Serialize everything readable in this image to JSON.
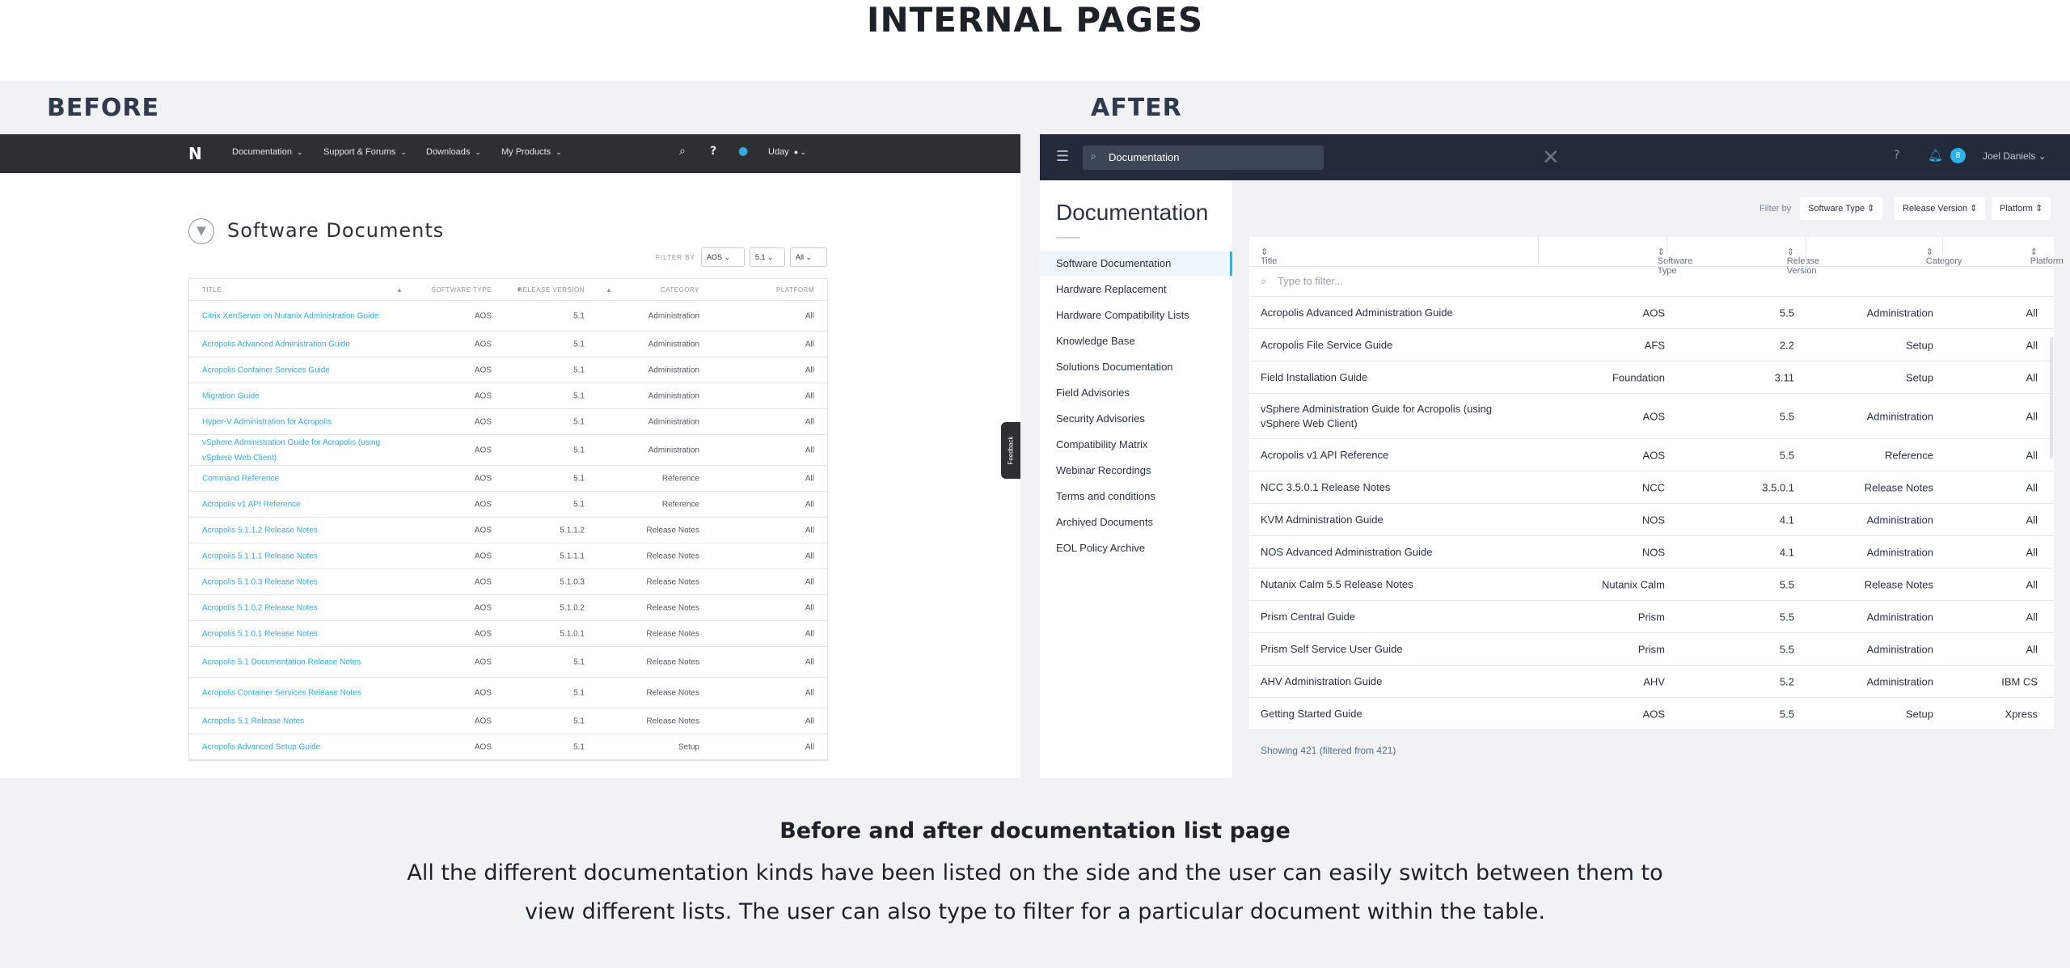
{
  "page": {
    "title": "INTERNAL PAGES",
    "before_label": "BEFORE",
    "after_label": "AFTER"
  },
  "before": {
    "nav": {
      "logo": "N",
      "items": [
        "Documentation",
        "Support & Forums",
        "Downloads",
        "My Products"
      ],
      "user": "Uday"
    },
    "heading": "Software Documents",
    "filter_by": "FILTER BY",
    "selects": [
      "AOS",
      "5.1",
      "All"
    ],
    "columns": [
      "TITLE",
      "SOFTWARE TYPE",
      "RELEASE VERSION",
      "CATEGORY",
      "PLATFORM"
    ],
    "rows": [
      [
        "Citrix XenServer on Nutanix Administration Guide",
        "AOS",
        "5.1",
        "Administration",
        "All"
      ],
      [
        "Acropolis Advanced Administration Guide",
        "AOS",
        "5.1",
        "Administration",
        "All"
      ],
      [
        "Acropolis Container Services Guide",
        "AOS",
        "5.1",
        "Administration",
        "All"
      ],
      [
        "Migration Guide",
        "AOS",
        "5.1",
        "Administration",
        "All"
      ],
      [
        "Hyper-V Administration for Acropolis",
        "AOS",
        "5.1",
        "Administration",
        "All"
      ],
      [
        "vSphere Administration Guide for Acropolis (using vSphere Web Client)",
        "AOS",
        "5.1",
        "Administration",
        "All"
      ],
      [
        "Command Reference",
        "AOS",
        "5.1",
        "Reference",
        "All"
      ],
      [
        "Acropolis v1 API Reference",
        "AOS",
        "5.1",
        "Reference",
        "All"
      ],
      [
        "Acropolis 5.1.1.2 Release Notes",
        "AOS",
        "5.1.1.2",
        "Release Notes",
        "All"
      ],
      [
        "Acropolis 5.1.1.1 Release Notes",
        "AOS",
        "5.1.1.1",
        "Release Notes",
        "All"
      ],
      [
        "Acropolis 5.1.0.3 Release Notes",
        "AOS",
        "5.1.0.3",
        "Release Notes",
        "All"
      ],
      [
        "Acropolis 5.1.0.2 Release Notes",
        "AOS",
        "5.1.0.2",
        "Release Notes",
        "All"
      ],
      [
        "Acropolis 5.1.0.1 Release Notes",
        "AOS",
        "5.1.0.1",
        "Release Notes",
        "All"
      ],
      [
        "Acropolis 5.1 Documentation Release Notes",
        "AOS",
        "5.1",
        "Release Notes",
        "All"
      ],
      [
        "Acropolis Container Services Release Notes",
        "AOS",
        "5.1",
        "Release Notes",
        "All"
      ],
      [
        "Acropolis 5.1 Release Notes",
        "AOS",
        "5.1",
        "Release Notes",
        "All"
      ],
      [
        "Acropolis Advanced Setup Guide",
        "AOS",
        "5.1",
        "Setup",
        "All"
      ]
    ],
    "feedback": "Feedback"
  },
  "after": {
    "nav": {
      "search_value": "Documentation",
      "badge": "8",
      "user": "Joel Daniels"
    },
    "sidebar": {
      "title": "Documentation",
      "items": [
        "Software Documentation",
        "Hardware Replacement",
        "Hardware Compatibility Lists",
        "Knowledge Base",
        "Solutions Documentation",
        "Field Advisories",
        "Security Advisories",
        "Compatibility Matrix",
        "Webinar Recordings",
        "Terms and conditions",
        "Archived Documents",
        "EOL Policy Archive"
      ]
    },
    "filter_by": "Filter by",
    "filters": [
      "Software Type",
      "Release Version",
      "Platform"
    ],
    "columns": [
      "Title",
      "Software Type",
      "Release Version",
      "Category",
      "Platform"
    ],
    "filter_placeholder": "Type to filter...",
    "rows": [
      [
        "Acropolis Advanced Administration Guide",
        "AOS",
        "5.5",
        "Administration",
        "All"
      ],
      [
        "Acropolis File Service Guide",
        "AFS",
        "2.2",
        "Setup",
        "All"
      ],
      [
        "Field Installation Guide",
        "Foundation",
        "3.11",
        "Setup",
        "All"
      ],
      [
        "vSphere Administration Guide for Acropolis (using vSphere Web Client)",
        "AOS",
        "5.5",
        "Administration",
        "All"
      ],
      [
        "Acropolis v1 API Reference",
        "AOS",
        "5.5",
        "Reference",
        "All"
      ],
      [
        "NCC 3.5.0.1 Release Notes",
        "NCC",
        "3.5.0.1",
        "Release Notes",
        "All"
      ],
      [
        "KVM Administration Guide",
        "NOS",
        "4.1",
        "Administration",
        "All"
      ],
      [
        "NOS Advanced Administration Guide",
        "NOS",
        "4.1",
        "Administration",
        "All"
      ],
      [
        "Nutanix Calm 5.5 Release Notes",
        "Nutanix Calm",
        "5.5",
        "Release Notes",
        "All"
      ],
      [
        "Prism Central Guide",
        "Prism",
        "5.5",
        "Administration",
        "All"
      ],
      [
        "Prism Self Service User Guide",
        "Prism",
        "5.5",
        "Administration",
        "All"
      ],
      [
        "AHV Administration Guide",
        "AHV",
        "5.2",
        "Administration",
        "IBM CS"
      ],
      [
        "Getting Started Guide",
        "AOS",
        "5.5",
        "Setup",
        "Xpress"
      ]
    ],
    "showing": "Showing 421 (filtered from 421)"
  },
  "caption": {
    "title": "Before and after documentation list page",
    "body": "All the different documentation kinds have been listed on the side and the user can easily switch between them to view different lists. The user can also type to filter for a particular document within the table."
  },
  "colors": {
    "before_link": "#30aee4",
    "after_nav": "#232b3a",
    "accent": "#2fb1ee"
  }
}
